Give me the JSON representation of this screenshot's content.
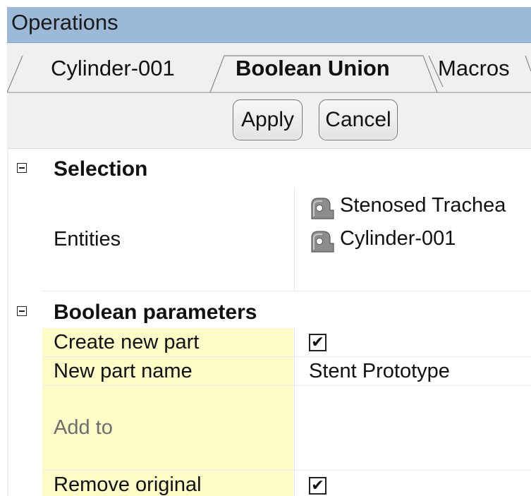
{
  "window": {
    "title": "Operations"
  },
  "tabs": [
    {
      "label": "Cylinder-001",
      "active": false
    },
    {
      "label": "Boolean Union",
      "active": true
    },
    {
      "label": "Macros",
      "active": false
    }
  ],
  "actions": {
    "apply_label": "Apply",
    "cancel_label": "Cancel"
  },
  "sections": {
    "selection": {
      "title": "Selection",
      "entities_label": "Entities",
      "entities": [
        "Stenosed Trachea",
        "Cylinder-001"
      ]
    },
    "boolean_parameters": {
      "title": "Boolean parameters",
      "create_new_part_label": "Create new part",
      "create_new_part_checked": true,
      "check_mark": "✔",
      "new_part_name_label": "New part name",
      "new_part_name_value": "Stent Prototype",
      "add_to_label": "Add to",
      "add_to_value": "",
      "remove_original_label": "Remove original",
      "remove_original_checked": true
    }
  },
  "colors": {
    "title_bar": "#9db9d8",
    "param_label_background": "#fdfbc7",
    "panel_background": "#f0f0f0"
  },
  "icons": {
    "entity_icon": "part-icon",
    "collapse_icon": "collapse-minus-icon"
  }
}
